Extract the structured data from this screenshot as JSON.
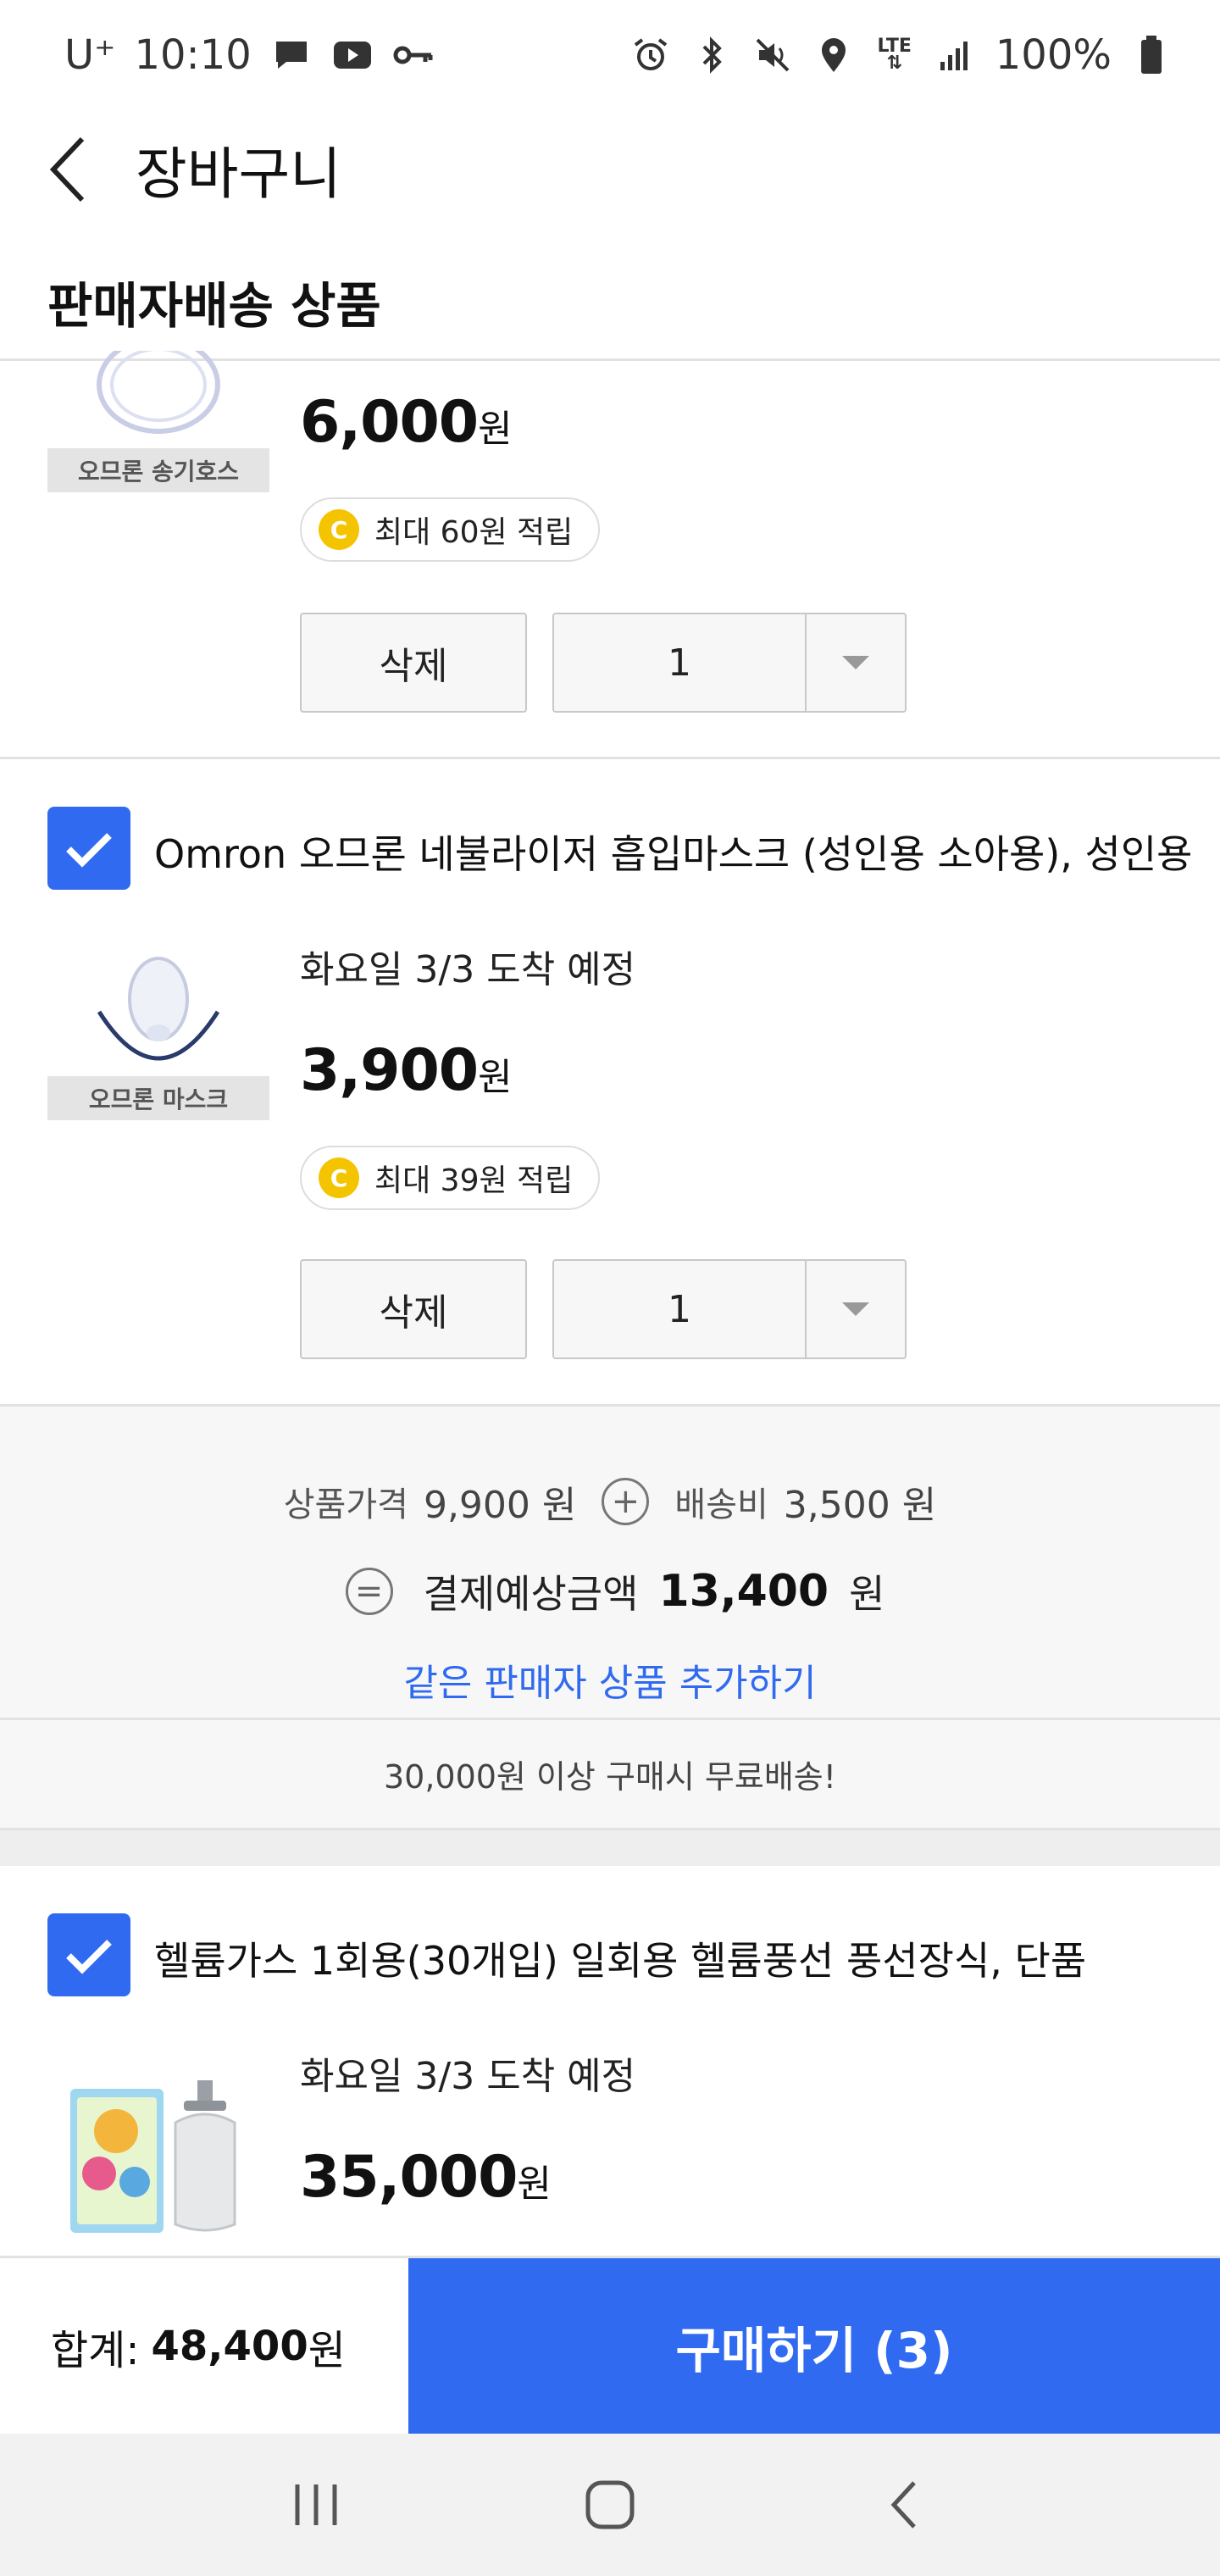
{
  "status_bar": {
    "carrier": "U⁺",
    "time": "10:10",
    "network": "LTE",
    "battery": "100%",
    "left_icons": [
      "message-icon",
      "youtube-icon",
      "key-icon"
    ],
    "right_icons": [
      "alarm-icon",
      "bluetooth-icon",
      "mute-icon",
      "location-icon",
      "lte-icon",
      "signal-icon",
      "battery-icon"
    ]
  },
  "header": {
    "title": "장바구니"
  },
  "section": {
    "title": "판매자배송 상품"
  },
  "items": [
    {
      "name": "",
      "delivery": "",
      "thumb_caption": "오므론 송기호스",
      "price": "6,000",
      "currency": "원",
      "points": "최대 60원 적립",
      "delete_label": "삭제",
      "quantity": "1",
      "checked": true
    },
    {
      "name": "Omron 오므론 네불라이저 흡입마스크 (성인용 소아용), 성인용",
      "delivery": "화요일 3/3 도착 예정",
      "thumb_caption": "오므론 마스크",
      "price": "3,900",
      "currency": "원",
      "points": "최대 39원 적립",
      "delete_label": "삭제",
      "quantity": "1",
      "checked": true
    },
    {
      "name": "헬륨가스 1회용(30개입) 일회용 헬륨풍선 풍선장식, 단품",
      "delivery": "화요일 3/3 도착 예정",
      "thumb_caption": "",
      "price": "35,000",
      "currency": "원",
      "checked": true
    }
  ],
  "points_badge": "C",
  "summary": {
    "product_price_label": "상품가격",
    "product_price": "9,900 원",
    "shipping_label": "배송비",
    "shipping": "3,500 원",
    "plus_symbol": "+",
    "equals_symbol": "=",
    "expected_label": "결제예상금액",
    "expected_total": "13,400",
    "expected_unit": "원",
    "add_same_seller": "같은 판매자 상품 추가하기"
  },
  "free_shipping_notice": "30,000원 이상 구매시 무료배송!",
  "bottom": {
    "total_label": "합계:",
    "total_value": "48,400",
    "total_unit": "원",
    "buy_label": "구매하기 (3)"
  },
  "colors": {
    "accent": "#2f6af0",
    "coin": "#f5c400",
    "divider": "#e2e2e2",
    "summary_bg": "#f7f7f7"
  }
}
